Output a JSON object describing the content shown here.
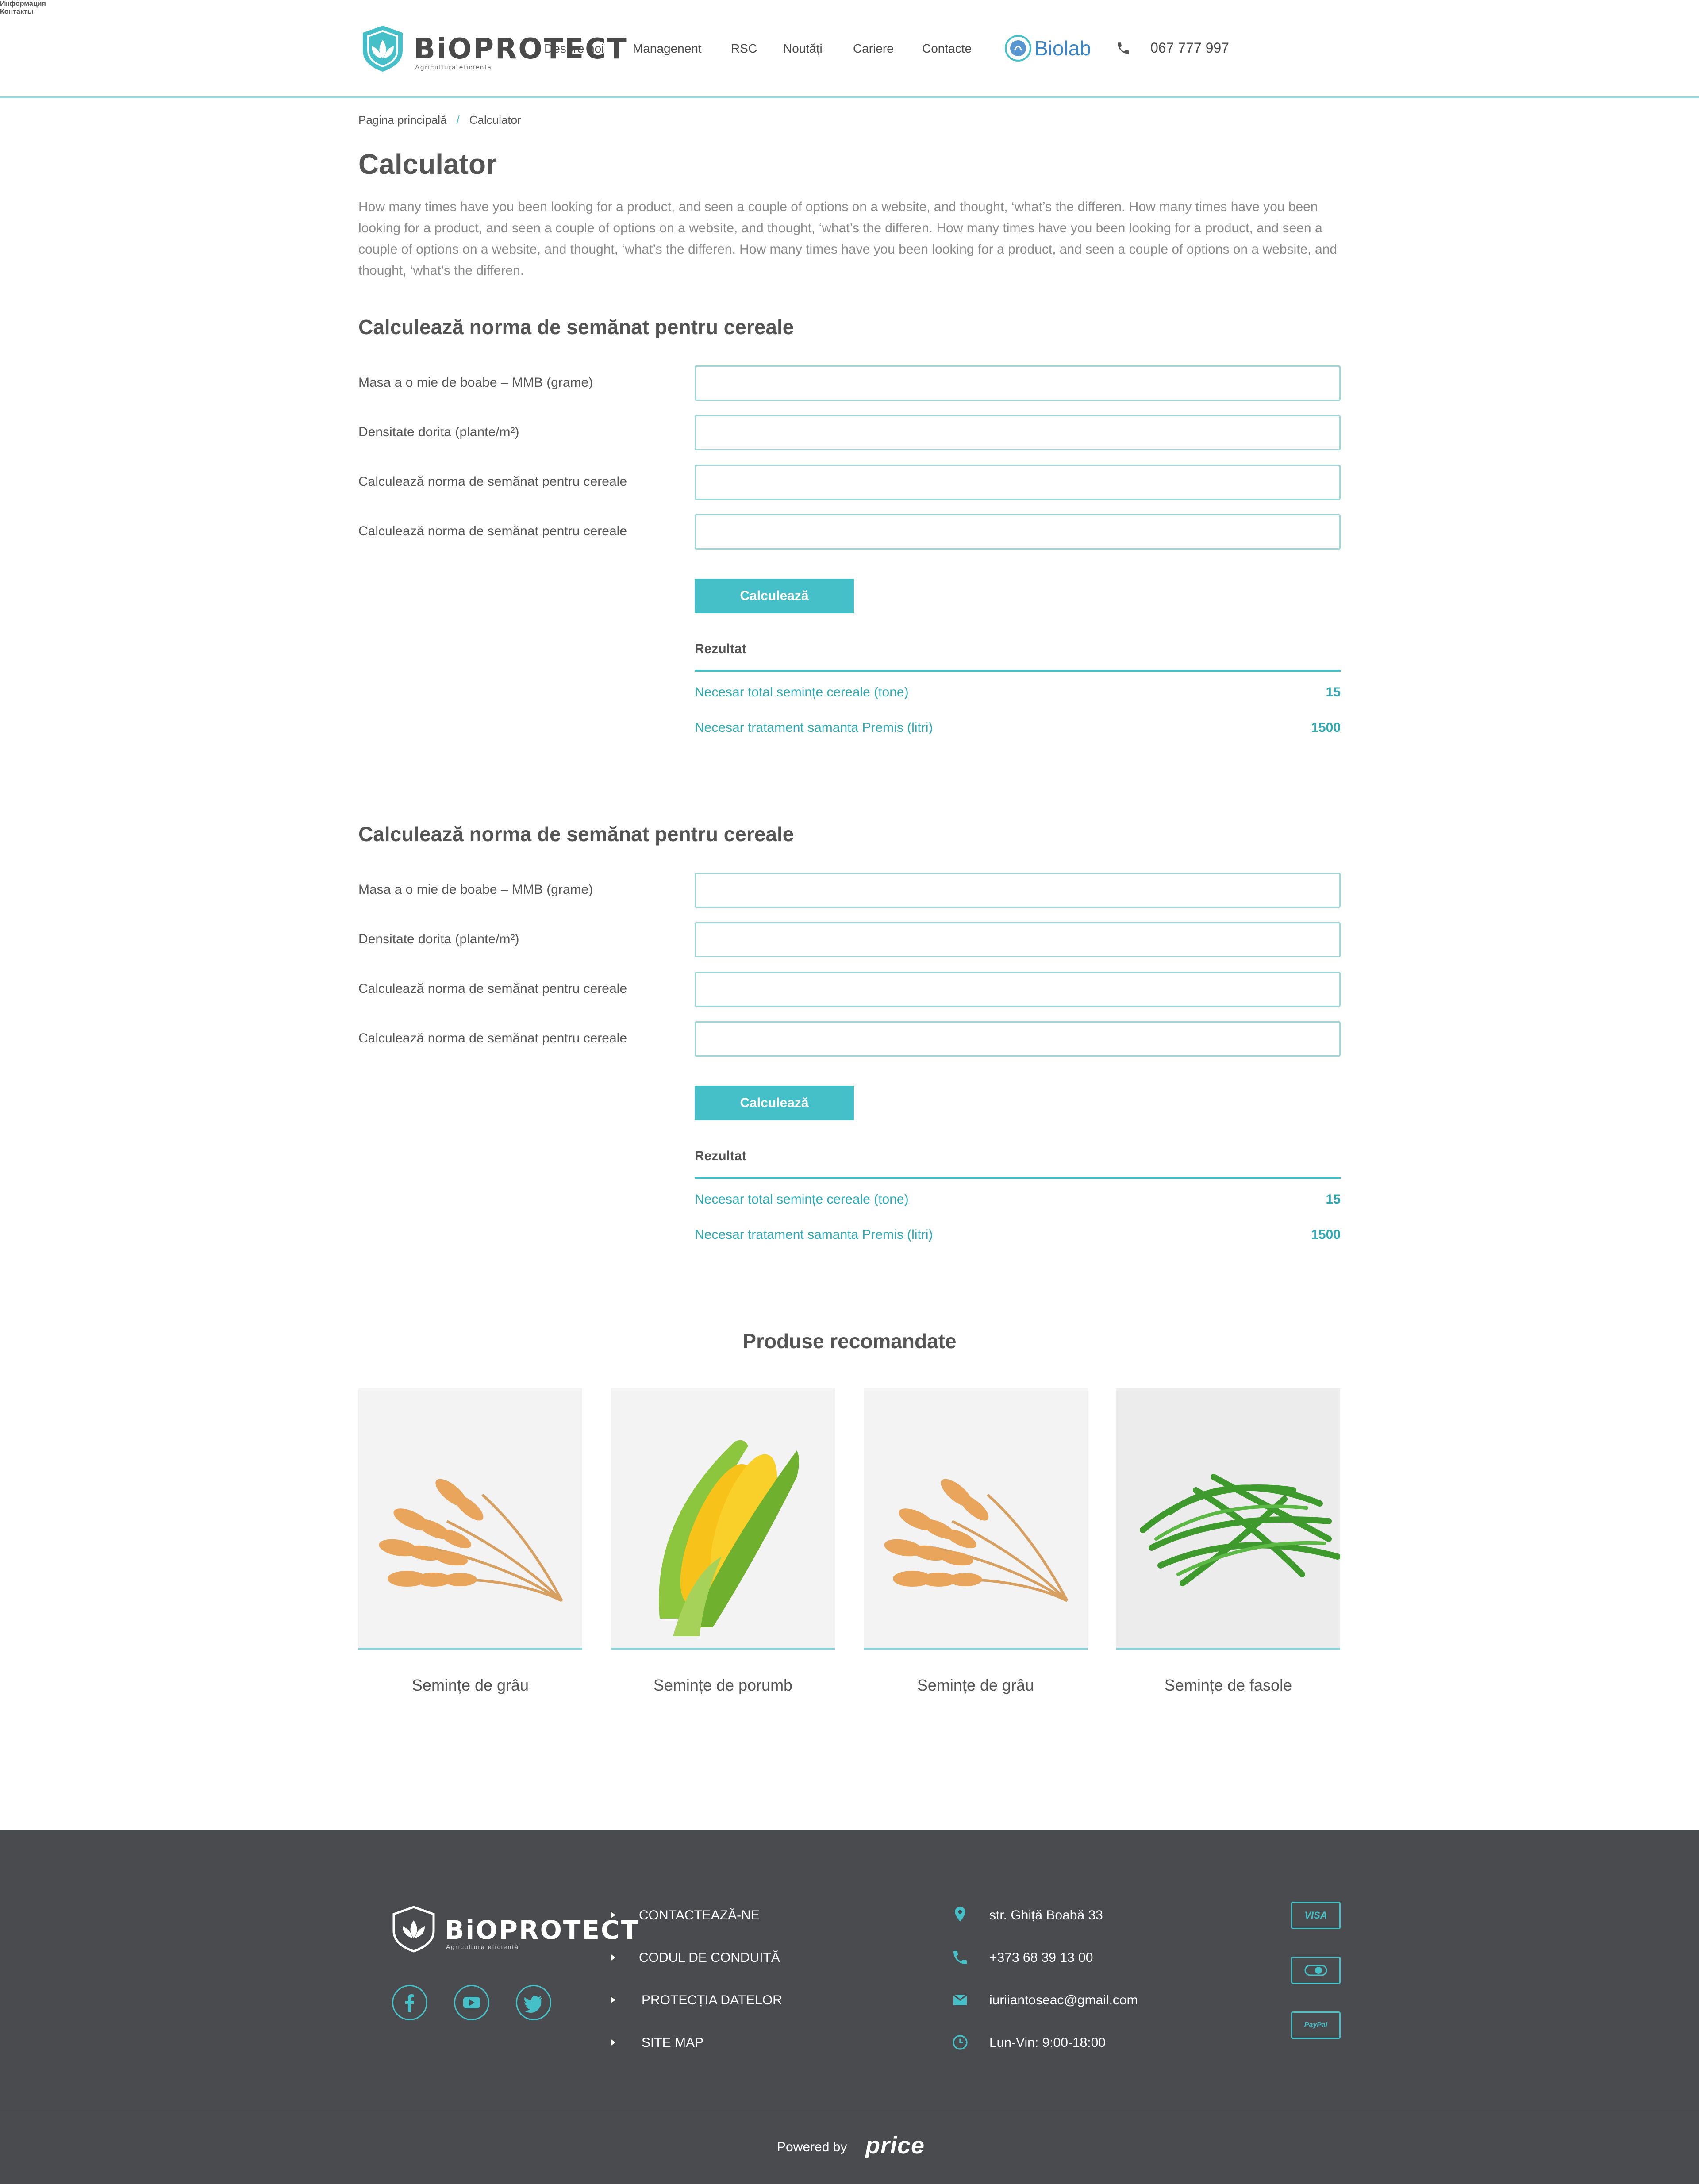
{
  "header": {
    "logo_text": "BiOPROTECT",
    "logo_tagline": "Agricultura eficientă",
    "nav": [
      {
        "label": "Despre noi"
      },
      {
        "label": "Managenent"
      },
      {
        "label": "RSC"
      },
      {
        "label": "Noutăți"
      },
      {
        "label": "Cariere"
      },
      {
        "label": "Contacte"
      }
    ],
    "partner_logo": "Biolab",
    "phone": "067 777 997"
  },
  "breadcrumb": {
    "home": "Pagina principală",
    "separator": "/",
    "current": "Calculator"
  },
  "page": {
    "title": "Calculator",
    "intro": "How many times have you been looking for a product, and seen a couple of options on a website, and thought, ‘what’s the differen. How many times have you been looking for a product, and seen a couple of options on a website, and thought, ‘what’s the differen. How many times have you been looking for a product, and seen a couple of options on a website, and thought, ‘what’s the differen. How many times have you been looking for a product, and seen a couple of options on a website, and thought, ‘what’s the differen."
  },
  "calculators": [
    {
      "title": "Calculează norma de semănat pentru cereale",
      "fields": [
        {
          "label": "Masa a o mie de boabe – MMB (grame)",
          "value": ""
        },
        {
          "label": "Densitate dorita (plante/m²)",
          "value": ""
        },
        {
          "label": "Calculează norma de semănat pentru cereale",
          "value": ""
        },
        {
          "label": "Calculează norma de semănat pentru cereale",
          "value": ""
        }
      ],
      "button": "Calculează",
      "result_title": "Rezultat",
      "results": [
        {
          "label": "Necesar total semințe cereale (tone)",
          "value": "15"
        },
        {
          "label": "Necesar tratament samanta Premis (litri)",
          "value": "1500"
        }
      ]
    },
    {
      "title": "Calculează norma de semănat pentru cereale",
      "fields": [
        {
          "label": "Masa a o mie de boabe – MMB (grame)",
          "value": ""
        },
        {
          "label": "Densitate dorita (plante/m²)",
          "value": ""
        },
        {
          "label": "Calculează norma de semănat pentru cereale",
          "value": ""
        },
        {
          "label": "Calculează norma de semănat pentru cereale",
          "value": ""
        }
      ],
      "button": "Calculează",
      "result_title": "Rezultat",
      "results": [
        {
          "label": "Necesar total semințe cereale (tone)",
          "value": "15"
        },
        {
          "label": "Necesar tratament samanta Premis (litri)",
          "value": "1500"
        }
      ]
    }
  ],
  "products": {
    "title": "Produse recomandate",
    "items": [
      {
        "name": "Semințe de grâu",
        "image": "wheat"
      },
      {
        "name": "Semințe de porumb",
        "image": "corn"
      },
      {
        "name": "Semințe de grâu",
        "image": "wheat"
      },
      {
        "name": "Semințe de fasole",
        "image": "beans"
      }
    ]
  },
  "footer": {
    "logo_text": "BiOPROTECT",
    "logo_tagline": "Agricultura eficientă",
    "social": [
      "facebook-icon",
      "youtube-icon",
      "twitter-icon"
    ],
    "info_title": "Информация",
    "info_links": [
      {
        "label": "CONTACTEAZĂ-NE"
      },
      {
        "label": "CODUL DE CONDUITĂ"
      },
      {
        "label": "PROTECȚIA DATELOR"
      },
      {
        "label": "SITE MAP"
      }
    ],
    "contacts_title": "Контакты",
    "contacts": [
      {
        "icon": "location-icon",
        "text": "str. Ghiță Boabă 33"
      },
      {
        "icon": "phone-icon",
        "text": "+373 68 39 13 00"
      },
      {
        "icon": "mail-icon",
        "text": "iuriiantoseac@gmail.com"
      },
      {
        "icon": "clock-icon",
        "text": "Lun-Vin: 9:00-18:00"
      }
    ],
    "payments": [
      {
        "label": "VISA"
      },
      {
        "label": ""
      },
      {
        "label": "PayPal"
      }
    ],
    "powered_by": "Powered by",
    "powered_logo": "price"
  },
  "colors": {
    "accent": "#46c0c8",
    "footer_bg": "#4a4b4e",
    "text": "#555555"
  }
}
